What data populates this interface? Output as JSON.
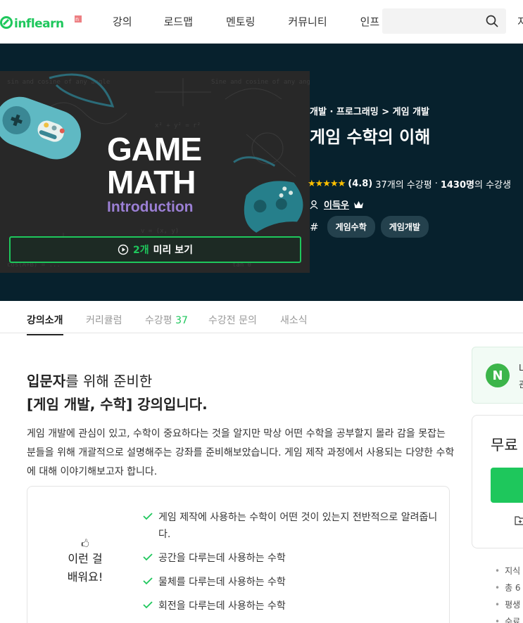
{
  "header": {
    "logo_text": "inflearn",
    "nav": [
      "강의",
      "로드맵",
      "멘토링",
      "커뮤니티",
      "인프"
    ],
    "search_placeholder": "",
    "extra": "지"
  },
  "hero": {
    "thumbnail": {
      "line1": "GAME",
      "line2": "MATH",
      "line3": "Introduction"
    },
    "preview_count": "2개",
    "preview_label": "미리 보기",
    "breadcrumb": "개발 · 프로그래밍 > 게임 개발",
    "title": "게임 수학의 이해",
    "stars": "★★★★★",
    "rating": "(4.8)",
    "review_count": "37개의 수강평",
    "separator": "·",
    "students": "1430명",
    "students_suffix": "의 수강생",
    "instructor": "이득우",
    "tags": [
      "게임수학",
      "게임개발"
    ]
  },
  "tabs": [
    {
      "label": "강의소개"
    },
    {
      "label": "커리큘럼"
    },
    {
      "label": "수강평",
      "count": "37"
    },
    {
      "label": "수강전 문의"
    },
    {
      "label": "새소식"
    }
  ],
  "intro": {
    "line1_bold": "입문자",
    "line1_rest": "를 위해 준비한",
    "line2": "[게임 개발, 수학] 강의입니다.",
    "description": "게임 개발에 관심이 있고, 수학이 중요하다는 것을 알지만 막상 어떤 수학을 공부할지 몰라 감을 못잡는 분들을 위해 개괄적으로 설명해주는 강좌를 준비해보았습니다. 게임 제작 과정에서 사용되는 다양한 수학에 대해 이야기해보고자 합니다."
  },
  "learn": {
    "emoji": "🖒",
    "label_line1": "이런 걸",
    "label_line2": "배워요!",
    "items": [
      "게임 제작에 사용하는 수학이 어떤 것이 있는지 전반적으로 알려줍니다.",
      "공간을 다루는데 사용하는 수학",
      "물체를 다루는데 사용하는 수학",
      "회전을 다루는데 사용하는 수학"
    ]
  },
  "side": {
    "badge": "N",
    "text1": "L",
    "text2": "관",
    "price_label": "무료",
    "info": [
      "지식",
      "총 6",
      "평생",
      "수료"
    ]
  },
  "colors": {
    "accent": "#1ec75c",
    "hero_bg": "#07212d",
    "tag_bg": "#24414d",
    "star": "#fdc000"
  }
}
